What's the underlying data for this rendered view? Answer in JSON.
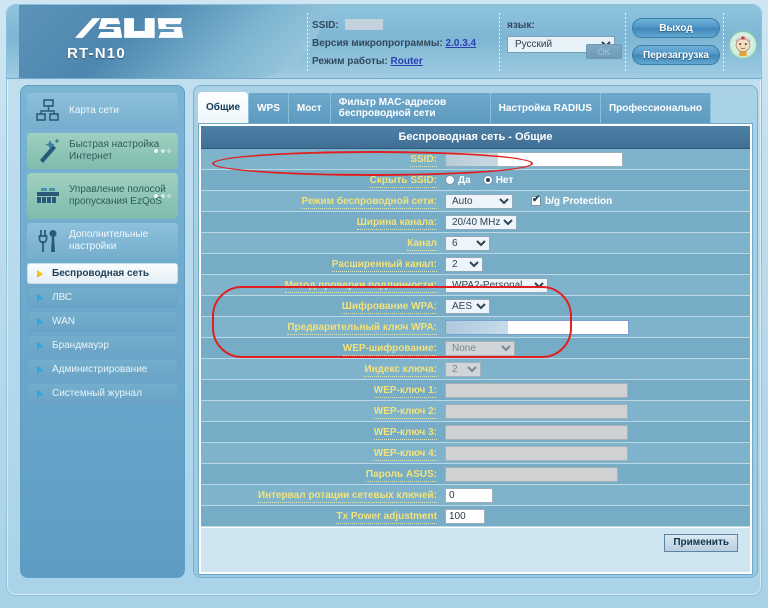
{
  "header": {
    "brand": "ASUS",
    "model": "RT-N10",
    "ssid_label": "SSID:",
    "ssid_value": "",
    "firmware_label": "Версия микропрограммы:",
    "firmware_value": "2.0.3.4",
    "opmode_label": "Режим работы:",
    "opmode_value": "Router",
    "language_label": "язык:",
    "language_value": "Русский",
    "language_ok": "OK",
    "logout_button": "Выход",
    "reboot_button": "Перезагрузка"
  },
  "sidebar": {
    "big_items": [
      {
        "label": "Карта сети",
        "icon": "network-map-icon",
        "style": "plain",
        "dots": false
      },
      {
        "label": "Быстрая настройка Интернет",
        "icon": "wizard-wand-icon",
        "style": "green",
        "dots": true
      },
      {
        "label": "Управление полосой пропускания EzQoS",
        "icon": "ezqos-icon",
        "style": "green",
        "dots": true
      },
      {
        "label": "Дополнительные настройки",
        "icon": "tools-icon",
        "style": "plain",
        "dots": false
      }
    ],
    "sub_items": [
      {
        "label": "Беспроводная сеть",
        "active": true
      },
      {
        "label": "ЛВС",
        "active": false
      },
      {
        "label": "WAN",
        "active": false
      },
      {
        "label": "Брандмауэр",
        "active": false
      },
      {
        "label": "Администрирование",
        "active": false
      },
      {
        "label": "Системный журнал",
        "active": false
      }
    ]
  },
  "tabs": [
    {
      "label": "Общие",
      "active": true
    },
    {
      "label": "WPS",
      "active": false
    },
    {
      "label": "Мост",
      "active": false
    },
    {
      "label": "Фильтр MAC-адресов беспроводной сети",
      "active": false
    },
    {
      "label": "Настройка RADIUS",
      "active": false
    },
    {
      "label": "Профессионально",
      "active": false
    }
  ],
  "panel": {
    "title": "Беспроводная сеть - Общие",
    "help_glyph": "?",
    "apply_button": "Применить"
  },
  "form": {
    "rows": [
      {
        "label": "SSID:",
        "type": "redacted-text",
        "value": ""
      },
      {
        "label": "Скрыть SSID:",
        "type": "radio",
        "options": [
          "Да",
          "Нет"
        ],
        "selected": "Нет"
      },
      {
        "label": "Режим беспроводной сети:",
        "type": "select",
        "value": "Auto",
        "checkbox": "b/g Protection",
        "checked": true
      },
      {
        "label": "Ширина канала:",
        "type": "select",
        "value": "20/40 MHz"
      },
      {
        "label": "Канал",
        "type": "select",
        "value": "6"
      },
      {
        "label": "Расширенный канал:",
        "type": "select",
        "value": "2"
      },
      {
        "label": "Метод проверки подлинности:",
        "type": "select",
        "value": "WPA2-Personal"
      },
      {
        "label": "Шифрование WPA:",
        "type": "select",
        "value": "AES"
      },
      {
        "label": "Предварительный ключ WPA:",
        "type": "redacted-password",
        "value": ""
      },
      {
        "label": "WEP-шифрование:",
        "type": "select-disabled",
        "value": "None"
      },
      {
        "label": "Индекс ключа:",
        "type": "select-disabled",
        "value": "2"
      },
      {
        "label": "WEP-ключ 1:",
        "type": "text-disabled",
        "value": ""
      },
      {
        "label": "WEP-ключ 2:",
        "type": "text-disabled",
        "value": ""
      },
      {
        "label": "WEP-ключ 3:",
        "type": "text-disabled",
        "value": ""
      },
      {
        "label": "WEP-ключ 4:",
        "type": "text-disabled",
        "value": ""
      },
      {
        "label": "Пароль ASUS:",
        "type": "text-disabled",
        "value": ""
      },
      {
        "label": "Интервал ротации сетевых ключей:",
        "type": "text",
        "value": "0"
      },
      {
        "label": "Tx Power adjustment",
        "type": "text",
        "value": "100"
      }
    ]
  },
  "highlights": {
    "ssid_note": "SSID field circled in red",
    "security_note": "Authentication method / WPA encryption / WPA pre-shared key circled in red",
    "color": "#e02020"
  }
}
